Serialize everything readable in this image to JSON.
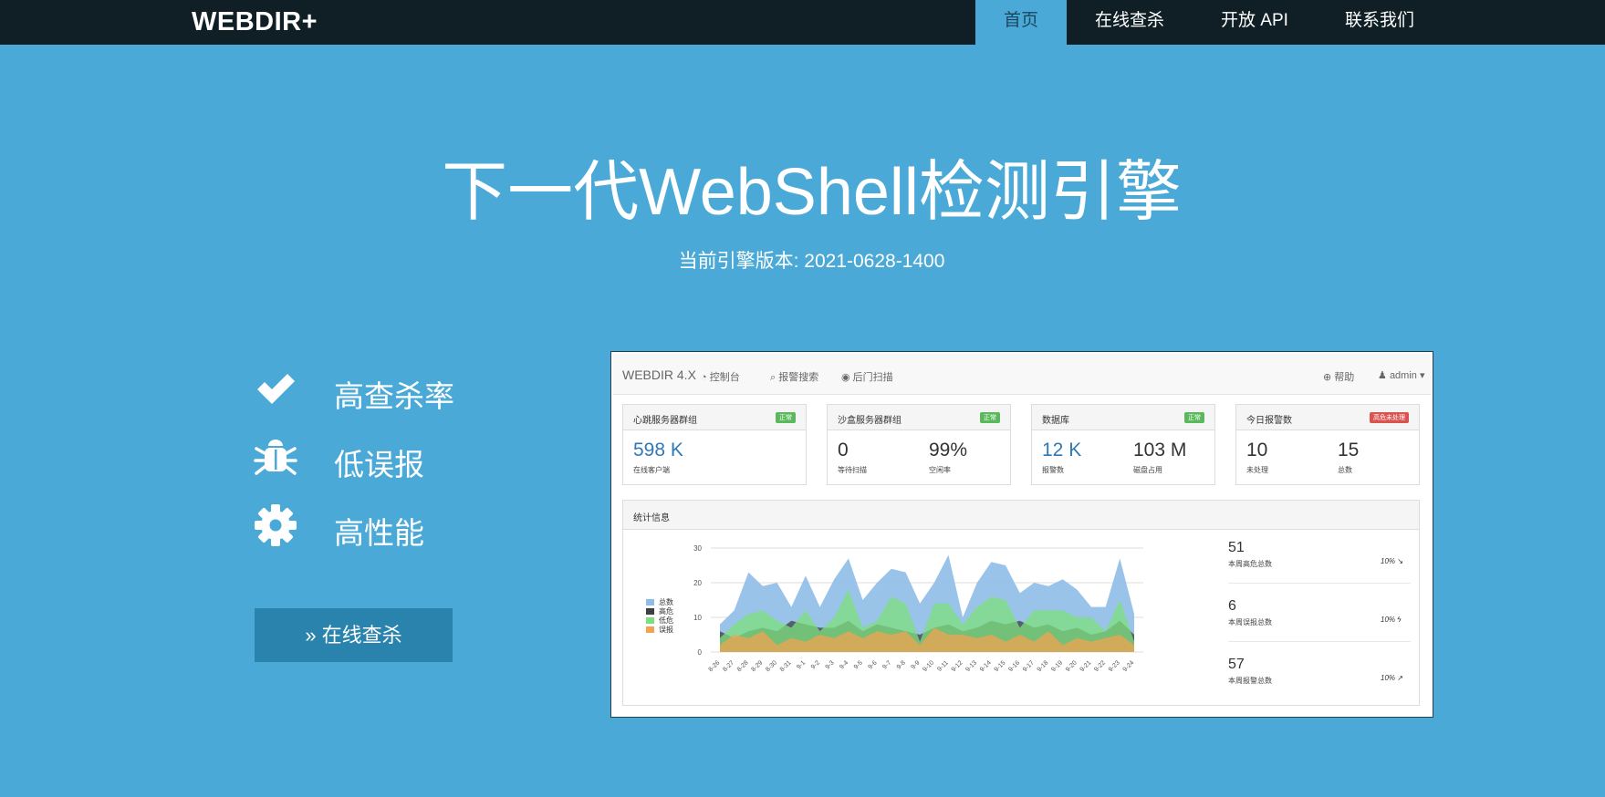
{
  "header": {
    "brand": "WEBDIR+",
    "nav": [
      {
        "label": "首页",
        "active": true
      },
      {
        "label": "在线查杀",
        "active": false
      },
      {
        "label": "开放 API",
        "active": false
      },
      {
        "label": "联系我们",
        "active": false
      }
    ]
  },
  "hero": {
    "title": "下一代WebShell检测引擎",
    "version": "当前引擎版本: 2021-0628-1400"
  },
  "features": [
    {
      "icon": "check-icon",
      "label": "高查杀率"
    },
    {
      "icon": "bug-icon",
      "label": "低误报"
    },
    {
      "icon": "gear-icon",
      "label": "高性能"
    }
  ],
  "cta": {
    "label": "» 在线查杀"
  },
  "screenshot": {
    "brand": "WEBDIR 4.X",
    "nav": [
      {
        "icon": "dashboard-icon",
        "label": "控制台"
      },
      {
        "icon": "search-icon",
        "label": "报警搜索"
      },
      {
        "icon": "eye-icon",
        "label": "后门扫描"
      }
    ],
    "help": "帮助",
    "user": "admin",
    "panels": [
      {
        "title": "心跳服务器群组",
        "badge": "正常",
        "badge_color": "#5cb85c",
        "stats": [
          {
            "value": "598 K",
            "label": "在线客户端",
            "highlight": true
          }
        ]
      },
      {
        "title": "沙盒服务器群组",
        "badge": "正常",
        "badge_color": "#5cb85c",
        "stats": [
          {
            "value": "0",
            "label": "等待扫描",
            "highlight": false
          },
          {
            "value": "99%",
            "label": "空闲率",
            "highlight": false
          }
        ]
      },
      {
        "title": "数据库",
        "badge": "正常",
        "badge_color": "#5cb85c",
        "stats": [
          {
            "value": "12 K",
            "label": "报警数",
            "highlight": true
          },
          {
            "value": "103 M",
            "label": "磁盘占用",
            "highlight": false
          }
        ]
      },
      {
        "title": "今日报警数",
        "badge": "高危未处理",
        "badge_color": "#d9534f",
        "stats": [
          {
            "value": "10",
            "label": "未处理",
            "highlight": false
          },
          {
            "value": "15",
            "label": "总数",
            "highlight": false
          }
        ]
      }
    ],
    "stats_panel_title": "统计信息",
    "right_stats": [
      {
        "value": "51",
        "label": "本周高危总数",
        "pct": "10% ↘"
      },
      {
        "value": "6",
        "label": "本周误报总数",
        "pct": "10% ϟ"
      },
      {
        "value": "57",
        "label": "本周报警总数",
        "pct": "10% ↗"
      }
    ]
  },
  "chart_data": {
    "type": "area",
    "x": [
      "8-26",
      "8-27",
      "8-28",
      "8-29",
      "8-30",
      "8-31",
      "9-1",
      "9-2",
      "9-3",
      "9-4",
      "9-5",
      "9-6",
      "9-7",
      "9-8",
      "9-9",
      "9-10",
      "9-11",
      "9-12",
      "9-13",
      "9-14",
      "9-15",
      "9-16",
      "9-17",
      "9-18",
      "9-19",
      "9-20",
      "9-21",
      "9-22",
      "9-23",
      "9-24"
    ],
    "ylim": [
      0,
      30
    ],
    "yticks": [
      0,
      10,
      20,
      30
    ],
    "grid": true,
    "legend_position": "left",
    "series": [
      {
        "name": "总数",
        "color": "#8fbde8",
        "values": [
          8,
          12,
          23,
          19,
          20,
          13,
          22,
          13,
          21,
          27,
          15,
          20,
          24,
          23,
          14,
          20,
          28,
          10,
          20,
          26,
          25,
          17,
          20,
          19,
          21,
          18,
          13,
          13,
          27,
          11
        ]
      },
      {
        "name": "高危",
        "color": "#3c3f44",
        "values": [
          6,
          4,
          6,
          7,
          6,
          9,
          8,
          7,
          7,
          9,
          6,
          8,
          7,
          6,
          5,
          7,
          8,
          6,
          7,
          9,
          8,
          9,
          7,
          8,
          6,
          7,
          5,
          6,
          9,
          5
        ]
      },
      {
        "name": "低危",
        "color": "#7ee07c",
        "values": [
          4,
          8,
          11,
          12,
          9,
          7,
          12,
          6,
          10,
          18,
          7,
          9,
          16,
          14,
          3,
          14,
          14,
          8,
          13,
          16,
          15,
          7,
          12,
          12,
          12,
          10,
          10,
          6,
          15,
          3
        ]
      },
      {
        "name": "误报",
        "color": "#f0a350",
        "values": [
          2,
          5,
          4,
          6,
          2,
          4,
          3,
          5,
          4,
          6,
          4,
          6,
          5,
          6,
          2,
          7,
          5,
          5,
          4,
          5,
          3,
          5,
          3,
          6,
          2,
          4,
          3,
          4,
          5,
          2
        ]
      }
    ]
  }
}
